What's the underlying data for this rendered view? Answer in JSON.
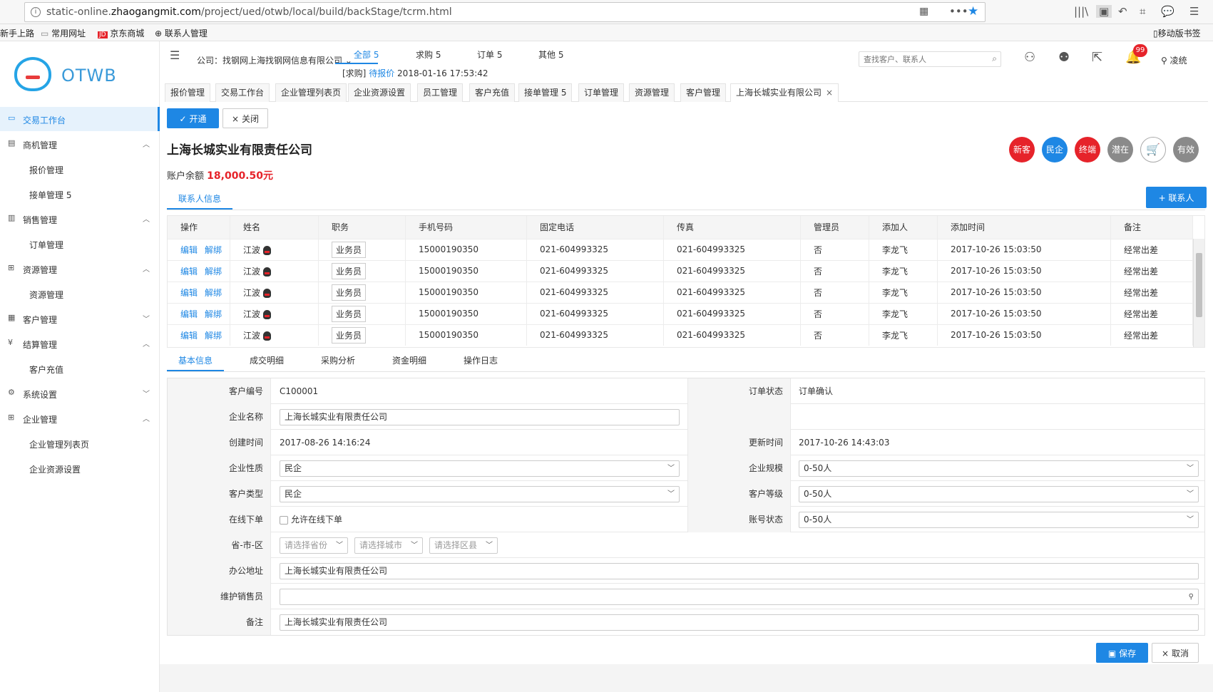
{
  "browser": {
    "url_prefix": "static-online.",
    "url_domain": "zhaogangmit.com",
    "url_path": "/project/ued/otwb/local/build/backStage/tcrm.html",
    "bookmarks": [
      "新手上路",
      "常用网址",
      "京东商城",
      "联系人管理"
    ],
    "mobile_bookmarks": "移动版书签"
  },
  "sidebar": {
    "logo": "OTWB",
    "items": [
      {
        "label": "交易工作台"
      },
      {
        "label": "商机管理"
      },
      {
        "label": "报价管理"
      },
      {
        "label": "接单管理 5"
      },
      {
        "label": "销售管理"
      },
      {
        "label": "订单管理"
      },
      {
        "label": "资源管理"
      },
      {
        "label": "资源管理"
      },
      {
        "label": "客户管理"
      },
      {
        "label": "结算管理"
      },
      {
        "label": "客户充值"
      },
      {
        "label": "系统设置"
      },
      {
        "label": "企业管理"
      },
      {
        "label": "企业管理列表页"
      },
      {
        "label": "企业资源设置"
      }
    ]
  },
  "header": {
    "company": "公司：找钢网上海找钢网信息有限公司",
    "tabs": [
      "全部 5",
      "求购 5",
      "订单 5",
      "其他 5"
    ],
    "sub_tag": "[求购]",
    "sub_link": "待报价",
    "sub_time": "2018-01-16 17:53:42",
    "search_placeholder": "查找客户、联系人",
    "badge": "99",
    "user": "凌统"
  },
  "page_tabs": [
    "报价管理",
    "交易工作台",
    "企业管理列表页",
    "企业资源设置",
    "员工管理",
    "客户充值",
    "接单管理 5",
    "订单管理",
    "资源管理",
    "客户管理",
    "上海长城实业有限公司"
  ],
  "actions": {
    "open": "开通",
    "close": "关闭"
  },
  "company": {
    "title": "上海长城实业有限责任公司",
    "balance_label": "账户余额",
    "balance": "18,000.50元",
    "tags": [
      {
        "label": "新客",
        "color": "#e6232a"
      },
      {
        "label": "民企",
        "color": "#1e87e4"
      },
      {
        "label": "终端",
        "color": "#e6232a"
      },
      {
        "label": "潜在",
        "color": "#8a8a8a"
      },
      {
        "label": "有效",
        "color": "#8a8a8a"
      }
    ]
  },
  "contacts": {
    "tab": "联系人信息",
    "add_button": "+ 联系人",
    "columns": [
      "操作",
      "姓名",
      "职务",
      "手机号码",
      "固定电话",
      "传真",
      "管理员",
      "添加人",
      "添加时间",
      "备注"
    ],
    "edit": "编辑",
    "unbind": "解绑",
    "rows": [
      {
        "name": "江波",
        "role": "业务员",
        "mobile": "15000190350",
        "phone": "021-604993325",
        "fax": "021-604993325",
        "admin": "否",
        "adder": "李龙飞",
        "time": "2017-10-26 15:03:50",
        "note": "经常出差"
      },
      {
        "name": "江波",
        "role": "业务员",
        "mobile": "15000190350",
        "phone": "021-604993325",
        "fax": "021-604993325",
        "admin": "否",
        "adder": "李龙飞",
        "time": "2017-10-26 15:03:50",
        "note": "经常出差"
      },
      {
        "name": "江波",
        "role": "业务员",
        "mobile": "15000190350",
        "phone": "021-604993325",
        "fax": "021-604993325",
        "admin": "否",
        "adder": "李龙飞",
        "time": "2017-10-26 15:03:50",
        "note": "经常出差"
      },
      {
        "name": "江波",
        "role": "业务员",
        "mobile": "15000190350",
        "phone": "021-604993325",
        "fax": "021-604993325",
        "admin": "否",
        "adder": "李龙飞",
        "time": "2017-10-26 15:03:50",
        "note": "经常出差"
      },
      {
        "name": "江波",
        "role": "业务员",
        "mobile": "15000190350",
        "phone": "021-604993325",
        "fax": "021-604993325",
        "admin": "否",
        "adder": "李龙飞",
        "time": "2017-10-26 15:03:50",
        "note": "经常出差"
      }
    ]
  },
  "detail_tabs": [
    "基本信息",
    "成交明细",
    "采购分析",
    "资金明细",
    "操作日志"
  ],
  "form": {
    "customer_no_label": "客户编号",
    "customer_no": "C100001",
    "order_status_label": "订单状态",
    "order_status": "订单确认",
    "company_name_label": "企业名称",
    "company_name": "上海长城实业有限责任公司",
    "created_label": "创建时间",
    "created": "2017-08-26 14:16:24",
    "updated_label": "更新时间",
    "updated": "2017-10-26 14:43:03",
    "nature_label": "企业性质",
    "nature": "民企",
    "scale_label": "企业规模",
    "scale": "0-50人",
    "ctype_label": "客户类型",
    "ctype": "民企",
    "level_label": "客户等级",
    "level": "0-50人",
    "online_label": "在线下单",
    "online_checkbox": "允许在线下单",
    "acct_label": "账号状态",
    "acct": "0-50人",
    "region_label": "省-市-区",
    "province_ph": "请选择省份",
    "city_ph": "请选择城市",
    "district_ph": "请选择区县",
    "address_label": "办公地址",
    "address": "上海长城实业有限责任公司",
    "sales_label": "维护销售员",
    "sales": "",
    "remark_label": "备注",
    "remark": "上海长城实业有限责任公司"
  },
  "footer": {
    "save": "保存",
    "cancel": "取消"
  }
}
